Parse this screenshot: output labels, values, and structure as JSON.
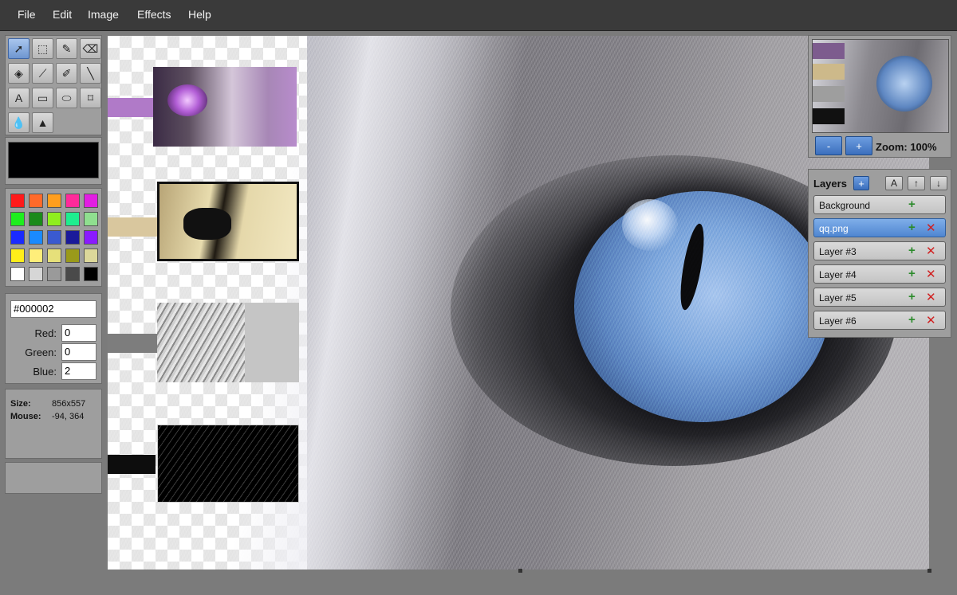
{
  "menu": [
    "File",
    "Edit",
    "Image",
    "Effects",
    "Help"
  ],
  "tools": [
    {
      "name": "select-arrow-icon",
      "glyph": "➚",
      "active": true
    },
    {
      "name": "rect-select-icon",
      "glyph": "⬚"
    },
    {
      "name": "magic-wand-icon",
      "glyph": "✎"
    },
    {
      "name": "eraser-icon",
      "glyph": "⌫"
    },
    {
      "name": "fill-bucket-icon",
      "glyph": "◈"
    },
    {
      "name": "eyedropper-icon",
      "glyph": "⟋"
    },
    {
      "name": "brush-icon",
      "glyph": "✐"
    },
    {
      "name": "line-icon",
      "glyph": "╲"
    },
    {
      "name": "text-icon",
      "glyph": "A"
    },
    {
      "name": "rectangle-icon",
      "glyph": "▭"
    },
    {
      "name": "ellipse-icon",
      "glyph": "⬭"
    },
    {
      "name": "spray-icon",
      "glyph": "⌑"
    },
    {
      "name": "blur-drop-icon",
      "glyph": "💧"
    },
    {
      "name": "sharpen-icon",
      "glyph": "▲"
    }
  ],
  "current_color": "#000002",
  "palette": [
    "#ff1a1a",
    "#ff6a2a",
    "#ff9e1e",
    "#ff2a9a",
    "#e21ee2",
    "#1eee1e",
    "#1a8a1a",
    "#8fee1e",
    "#1eee8f",
    "#8fdf8f",
    "#1a2aff",
    "#1a8aff",
    "#3a5ad0",
    "#1a1a9a",
    "#8a1aff",
    "#ffee1a",
    "#ffee7a",
    "#e6e07a",
    "#9a9a1a",
    "#dcd89a",
    "#ffffff",
    "#d6d6d6",
    "#9a9a9a",
    "#4a4a4a",
    "#000000"
  ],
  "color_fields": {
    "hex": "#000002",
    "red_label": "Red:",
    "red": "0",
    "green_label": "Green:",
    "green": "0",
    "blue_label": "Blue:",
    "blue": "2"
  },
  "info": {
    "size_label": "Size:",
    "size": "856x557",
    "mouse_label": "Mouse:",
    "mouse": "-94, 364"
  },
  "navigator": {
    "zoom_out": "-",
    "zoom_in": "+",
    "zoom_text": "Zoom: 100%"
  },
  "layers_panel": {
    "title": "Layers",
    "add_button": "+",
    "a_button": "A",
    "up_button": "↑",
    "down_button": "↓",
    "items": [
      {
        "name": "Background",
        "selected": false,
        "deletable": false
      },
      {
        "name": "qq.png",
        "selected": true,
        "deletable": true
      },
      {
        "name": "Layer #3",
        "selected": false,
        "deletable": true
      },
      {
        "name": "Layer #4",
        "selected": false,
        "deletable": true
      },
      {
        "name": "Layer #5",
        "selected": false,
        "deletable": true
      },
      {
        "name": "Layer #6",
        "selected": false,
        "deletable": true
      }
    ],
    "visible_glyph": "+",
    "delete_glyph": "✕"
  },
  "colors": {
    "menubar": "#3a3a3a",
    "panel": "#9e9e9e",
    "accent": "#4f86d1"
  }
}
